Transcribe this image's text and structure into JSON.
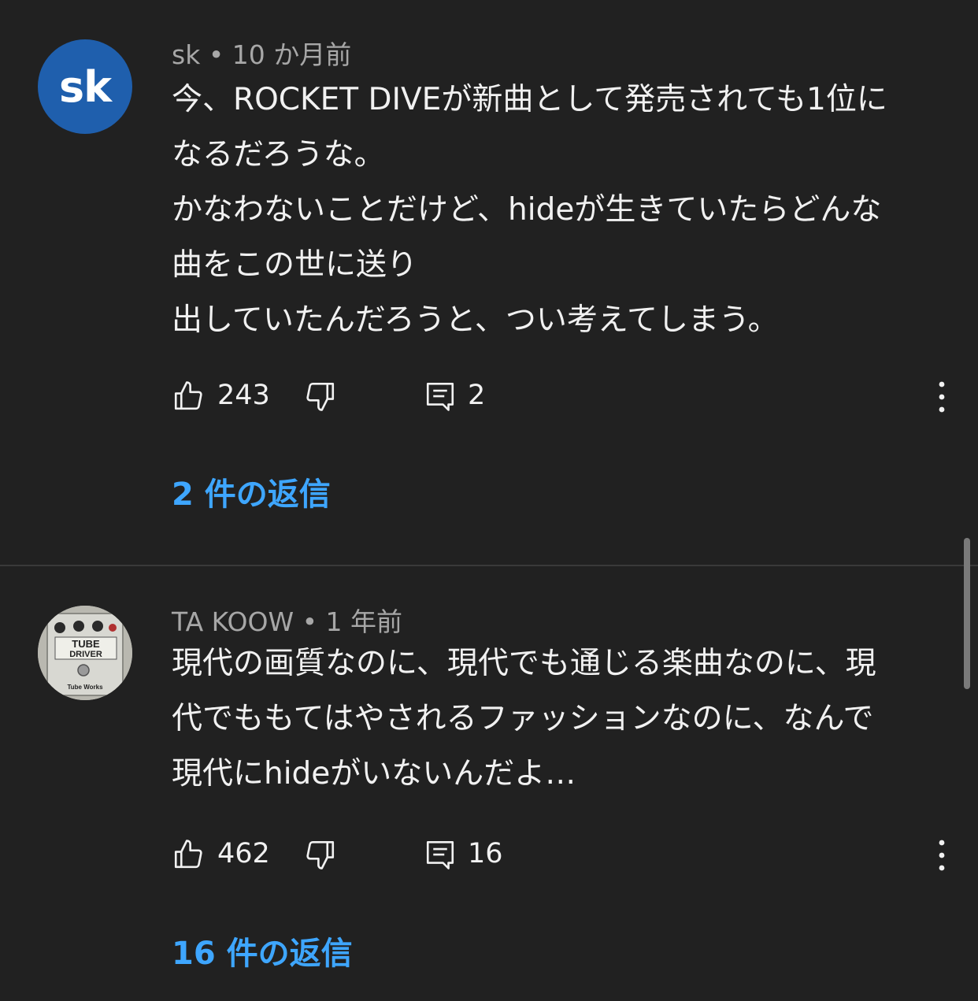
{
  "comments": [
    {
      "author": "sk",
      "time": "10 か月前",
      "avatar_text": "sk",
      "avatar_color": "#1f5fad",
      "lines": [
        "今、ROCKET DIVEが新曲として発売されても1位に",
        "なるだろうな。",
        "かなわないことだけど、hideが生きていたらどんな",
        "曲をこの世に送り",
        "出していたんだろうと、つい考えてしまう。"
      ],
      "likes": "243",
      "reply_count": "2",
      "replies_label": "2 件の返信"
    },
    {
      "author": "TA KOOW",
      "time": "1 年前",
      "avatar_image": "tube-driver-pedal",
      "pedal_text": [
        "TUBE",
        "DRIVER",
        "Tube Works"
      ],
      "lines": [
        "現代の画質なのに、現代でも通じる楽曲なのに、現",
        "代でももてはやされるファッションなのに、なんで",
        "現代にhideがいないんだよ…"
      ],
      "likes": "462",
      "reply_count": "16",
      "replies_label": "16 件の返信"
    }
  ],
  "meta_separator": "•",
  "colors": {
    "background": "#212121",
    "text": "#f1f1f1",
    "meta": "#a7a7a7",
    "link": "#3ea6ff",
    "divider": "#3a3a3a"
  }
}
